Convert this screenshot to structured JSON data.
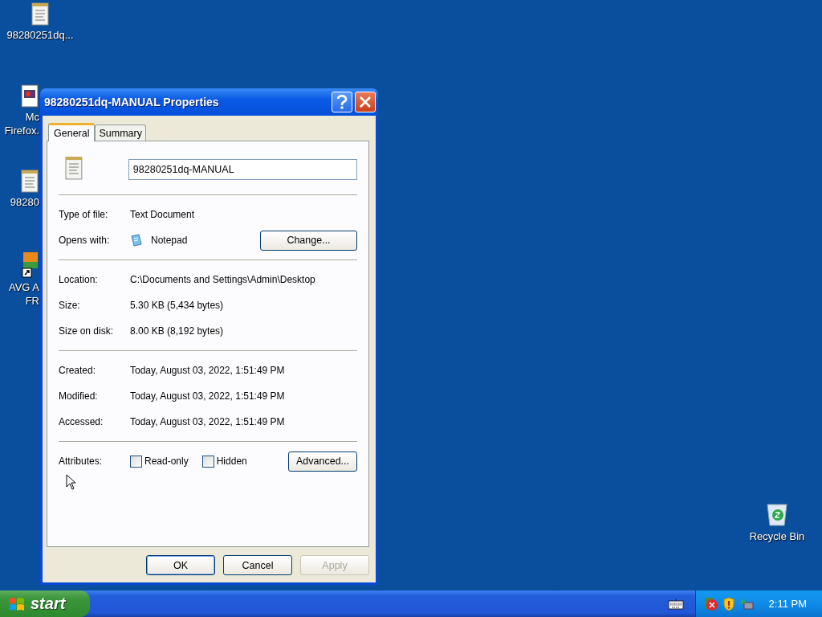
{
  "desktop_icons": [
    {
      "kind": "document",
      "lines": [
        "98280251dq..."
      ]
    },
    {
      "kind": "webpage",
      "lines": [
        "Mc",
        "Firefox."
      ]
    },
    {
      "kind": "document",
      "lines": [
        "98280"
      ]
    },
    {
      "kind": "shortcut",
      "lines": [
        "AVG A",
        "FR"
      ]
    },
    {
      "kind": "recycle",
      "lines": [
        "Recycle Bin"
      ]
    }
  ],
  "dialog": {
    "title": "98280251dq-MANUAL Properties",
    "tabs": [
      {
        "label": "General",
        "selected": true
      },
      {
        "label": "Summary",
        "selected": false
      }
    ],
    "file_name": "98280251dq-MANUAL",
    "groups": [
      [
        {
          "label": "Type of file:",
          "value": "Text Document"
        },
        {
          "label": "Opens with:",
          "value": "Notepad",
          "app_icon": true,
          "button": "Change..."
        }
      ],
      [
        {
          "label": "Location:",
          "value": "C:\\Documents and Settings\\Admin\\Desktop"
        },
        {
          "label": "Size:",
          "value": "5.30 KB (5,434 bytes)"
        },
        {
          "label": "Size on disk:",
          "value": "8.00 KB (8,192 bytes)"
        }
      ],
      [
        {
          "label": "Created:",
          "value": "Today, August 03, 2022, 1:51:49 PM"
        },
        {
          "label": "Modified:",
          "value": "Today, August 03, 2022, 1:51:49 PM"
        },
        {
          "label": "Accessed:",
          "value": "Today, August 03, 2022, 1:51:49 PM"
        }
      ]
    ],
    "attributes": {
      "label": "Attributes:",
      "checkboxes": [
        {
          "label": "Read-only",
          "checked": false
        },
        {
          "label": "Hidden",
          "checked": false
        }
      ],
      "button": "Advanced..."
    },
    "buttons": [
      {
        "label": "OK",
        "default": true,
        "disabled": false
      },
      {
        "label": "Cancel",
        "default": false,
        "disabled": false
      },
      {
        "label": "Apply",
        "default": false,
        "disabled": true
      }
    ]
  },
  "taskbar": {
    "start": "start",
    "clock": "2:11 PM"
  }
}
